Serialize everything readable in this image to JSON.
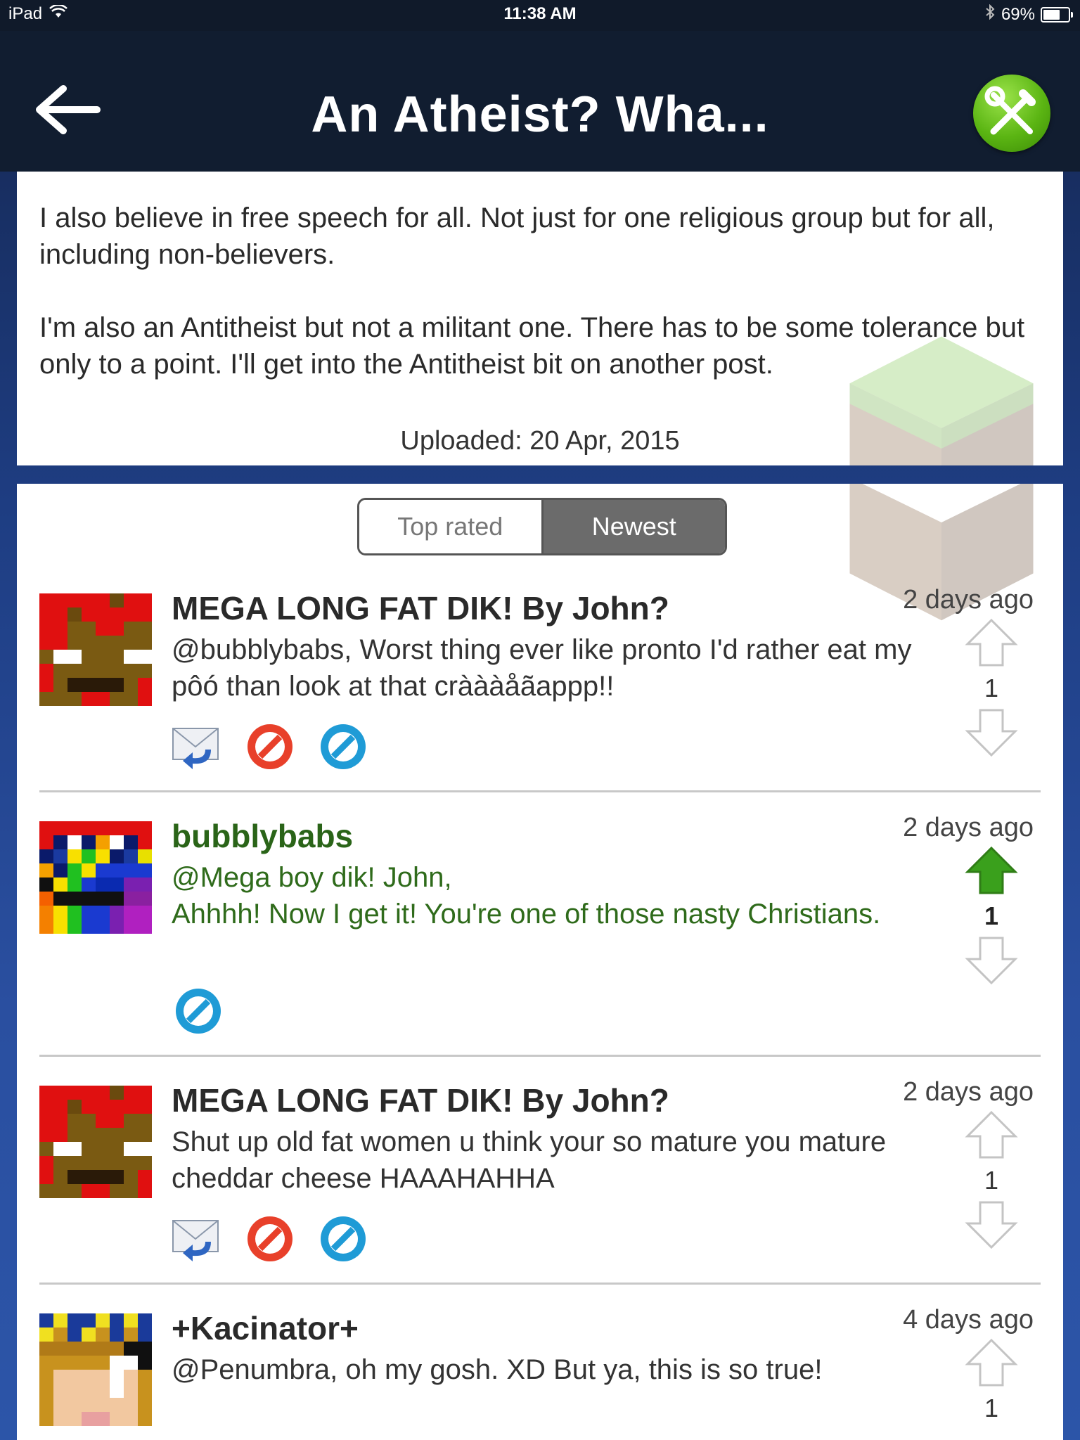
{
  "status_bar": {
    "device": "iPad",
    "time": "11:38 AM",
    "battery": "69%",
    "battery_level": 0.69
  },
  "nav": {
    "title": "An Atheist?  Wha..."
  },
  "post": {
    "paragraphs": [
      "I also believe in free speech for all.  Not just for one religious group but for all, including non-believers.",
      "I'm also an Antitheist but not a militant one.  There has to be some tolerance but only to a point.  I'll get into the Antitheist bit on another post."
    ],
    "uploaded": "Uploaded: 20 Apr, 2015"
  },
  "sort_tabs": {
    "top_rated": "Top rated",
    "newest": "Newest",
    "selected": "Newest"
  },
  "comments": [
    {
      "author": "MEGA LONG FAT DIK! By John?",
      "time": "2 days ago",
      "body": [
        "@bubblybabs, Worst thing ever like pronto I'd rather eat my pôó than look at that cràààåãappp!!"
      ],
      "score": "1",
      "upvoted": false
    },
    {
      "author": "bubblybabs",
      "time": "2 days ago",
      "body": [
        "@Mega boy dik! John,",
        "Ahhhh! Now I get it! You're one of those nasty Christians."
      ],
      "score": "1",
      "upvoted": true
    },
    {
      "author": "MEGA LONG FAT DIK! By John?",
      "time": "2 days ago",
      "body": [
        "Shut up old fat women u think your so mature you mature cheddar cheese HAAAHAHHA"
      ],
      "score": "1",
      "upvoted": false
    },
    {
      "author": "+Kacinator+",
      "time": "4 days ago",
      "body": [
        "@Penumbra, oh my gosh. XD But ya, this is so true!"
      ],
      "score": "1",
      "upvoted": false
    }
  ],
  "icons": {
    "back": "back-arrow-icon",
    "tools": "tools-icon",
    "reply": "reply-envelope-icon",
    "report": "report-icon",
    "block": "block-icon",
    "upvote": "upvote-arrow-icon",
    "downvote": "downvote-arrow-icon"
  },
  "colors": {
    "nav_bg": "#111d30",
    "accent_green": "#5bb513",
    "author_green": "#2a6418",
    "upvote_active": "#3aa01c"
  }
}
